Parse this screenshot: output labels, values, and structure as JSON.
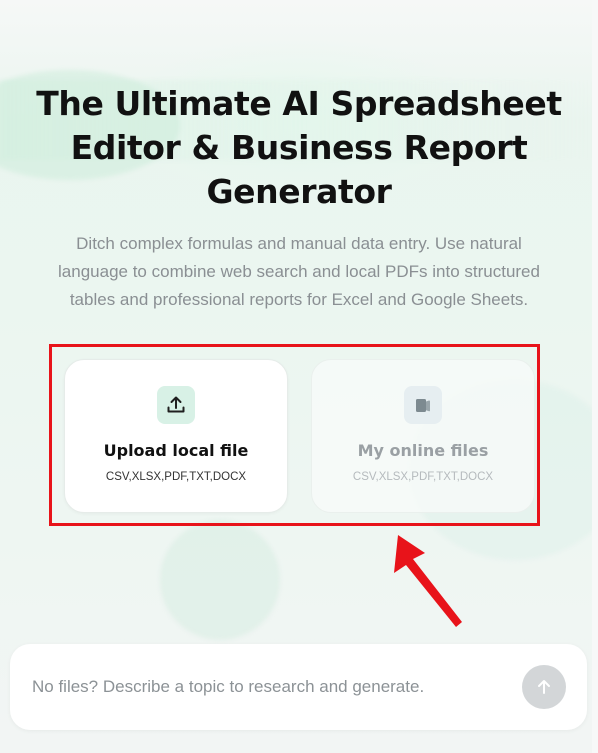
{
  "hero": {
    "title_line1": "The Ultimate AI Spreadsheet",
    "title_line2": "Editor & Business Report",
    "title_line3": "Generator",
    "subtitle_line1": "Ditch complex formulas and manual data entry. Use natural",
    "subtitle_line2": "language to combine web search and local PDFs into structured",
    "subtitle_line3": "tables and professional reports for Excel and Google Sheets."
  },
  "cards": {
    "upload": {
      "icon": "upload-icon",
      "label": "Upload local file",
      "formats": "CSV,XLSX,PDF,TXT,DOCX"
    },
    "online": {
      "icon": "cloud-files-icon",
      "label": "My online files",
      "formats": "CSV,XLSX,PDF,TXT,DOCX"
    }
  },
  "annotation": {
    "highlight_color": "#e8131a",
    "arrow_color": "#e8131a"
  },
  "prompt": {
    "placeholder": "No files? Describe a topic to research and generate.",
    "value": "",
    "send_icon": "arrow-up-icon"
  },
  "colors": {
    "accent_green": "#1f8f63",
    "upload_icon_bg": "#d8f1e6",
    "send_button_bg": "#d3d6d8"
  }
}
